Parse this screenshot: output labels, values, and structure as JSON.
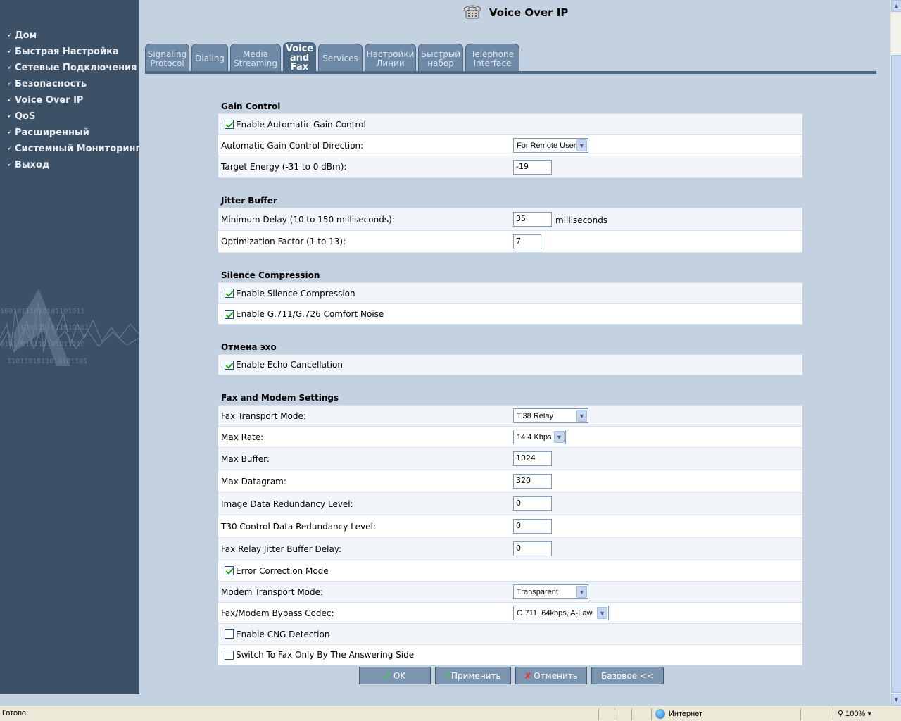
{
  "sidebar": {
    "items": [
      "Дом",
      "Быстрая Настройка",
      "Сетевые Подключения",
      "Безопасность",
      "Voice Over IP",
      "QoS",
      "Расширенный",
      "Системный Мониторинг",
      "Выход"
    ]
  },
  "header": {
    "title": "Voice Over IP"
  },
  "tabs": [
    {
      "label": "Signaling\nProtocol",
      "active": false
    },
    {
      "label": "Dialing",
      "active": false
    },
    {
      "label": "Media\nStreaming",
      "active": false
    },
    {
      "label": "Voice\nand\nFax",
      "active": true
    },
    {
      "label": "Services",
      "active": false
    },
    {
      "label": "Настройки\nЛинии",
      "active": false
    },
    {
      "label": "Быстрый\nнабор",
      "active": false
    },
    {
      "label": "Telephone\nInterface",
      "active": false
    }
  ],
  "gain": {
    "title": "Gain Control",
    "agc_label": "Enable Automatic Gain Control",
    "direction_label": "Automatic Gain Control Direction:",
    "direction_value": "For Remote User",
    "target_label": "Target Energy (-31 to 0 dBm):",
    "target_value": "-19"
  },
  "jitter": {
    "title": "Jitter Buffer",
    "min_delay_label": "Minimum Delay (10 to 150 milliseconds):",
    "min_delay_value": "35",
    "min_delay_unit": "milliseconds",
    "opt_label": "Optimization Factor (1 to 13):",
    "opt_value": "7"
  },
  "silence": {
    "title": "Silence Compression",
    "enable_label": "Enable Silence Compression",
    "comfort_label": "Enable G.711/G.726 Comfort Noise"
  },
  "echo": {
    "title": "Отмена эхо",
    "enable_label": "Enable Echo Cancellation"
  },
  "fax": {
    "title": "Fax and Modem Settings",
    "transport_label": "Fax Transport Mode:",
    "transport_value": "T.38 Relay",
    "max_rate_label": "Max Rate:",
    "max_rate_value": "14.4 Kbps",
    "max_buffer_label": "Max Buffer:",
    "max_buffer_value": "1024",
    "max_datagram_label": "Max Datagram:",
    "max_datagram_value": "320",
    "image_red_label": "Image Data Redundancy Level:",
    "image_red_value": "0",
    "t30_label": "T30 Control Data Redundancy Level:",
    "t30_value": "0",
    "jitter_label": "Fax Relay Jitter Buffer Delay:",
    "jitter_value": "0",
    "ecm_label": "Error Correction Mode",
    "modem_label": "Modem Transport Mode:",
    "modem_value": "Transparent",
    "bypass_label": "Fax/Modem Bypass Codec:",
    "bypass_value": "G.711, 64kbps, A-Law",
    "cng_label": "Enable CNG Detection",
    "switch_label": "Switch To Fax Only By The Answering Side"
  },
  "buttons": {
    "ok": "OK",
    "apply": "Применить",
    "cancel": "Отменить",
    "basic": "Базовое <<"
  },
  "statusbar": {
    "status": "Готово",
    "zone": "Интернет",
    "zoom": "100%"
  }
}
